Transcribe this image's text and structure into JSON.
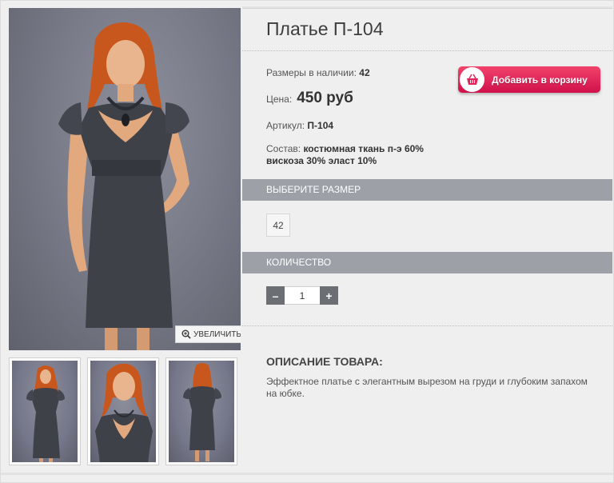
{
  "product": {
    "title": "Платье П-104",
    "sizes_label": "Размеры в наличии:",
    "sizes_value": "42",
    "price_label": "Цена:",
    "price_value": "450 руб",
    "sku_label": "Артикул:",
    "sku_value": "П-104",
    "composition_label": "Состав:",
    "composition_line1": "костюмная ткань п-э 60%",
    "composition_line2": "вискоза 30% эласт 10%"
  },
  "cart_button": {
    "label": "Добавить в корзину",
    "icon": "basket-icon"
  },
  "size_section": {
    "title": "ВЫБЕРИТЕ РАЗМЕР",
    "options": [
      "42"
    ]
  },
  "qty_section": {
    "title": "КОЛИЧЕСТВО",
    "value": "1",
    "minus": "–",
    "plus": "+"
  },
  "gallery": {
    "zoom_label": "УВЕЛИЧИТЬ",
    "zoom_icon": "zoom-in-icon"
  },
  "description": {
    "title": "ОПИСАНИЕ ТОВАРА:",
    "text": "Эффектное платье с элегантным вырезом на груди и глубоким запахом на юбке."
  },
  "colors": {
    "cart_button": "#e0255a",
    "section_bar": "#9da1a7",
    "stepper_button": "#6b6e73"
  }
}
